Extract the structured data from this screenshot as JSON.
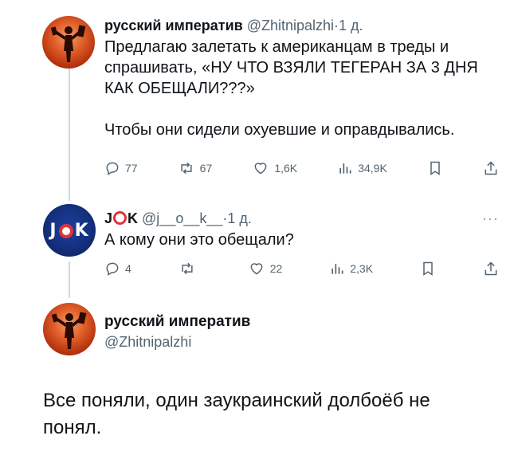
{
  "tweet1": {
    "author_name": "русский императив",
    "author_handle": "@Zhitnipalzhi",
    "separator": "·",
    "time": "1 д.",
    "text_line1": "Предлагаю залетать к американцам в треды и спрашивать, «НУ ЧТО ВЗЯЛИ ТЕГЕРАН ЗА 3 ДНЯ КАК ОБЕЩАЛИ???»",
    "text_line2": "Чтобы они сидели охуевшие и оправдывались.",
    "replies": "77",
    "reposts": "67",
    "likes": "1,6K",
    "views": "34,9K"
  },
  "tweet2": {
    "author_name_prefix": "J",
    "author_name_suffix": "K",
    "author_handle": "@j__o__k__",
    "separator": "·",
    "time": "1 д.",
    "more": "···",
    "text": "А кому они это обещали?",
    "replies": "4",
    "reposts": "",
    "likes": "22",
    "views": "2,3K",
    "avatar_text_left": "J",
    "avatar_text_right": "K"
  },
  "tweet3": {
    "author_name": "русский императив",
    "author_handle": "@Zhitnipalzhi",
    "text": "Все поняли, один заукраинский долбоёб не понял."
  },
  "icons": [
    "reply-icon",
    "repost-icon",
    "like-icon",
    "views-icon",
    "bookmark-icon",
    "share-icon"
  ],
  "colors": {
    "text": "#0f1419",
    "secondary": "#536471",
    "thread_line": "#cfd9de",
    "ring_red": "#e0323a"
  }
}
